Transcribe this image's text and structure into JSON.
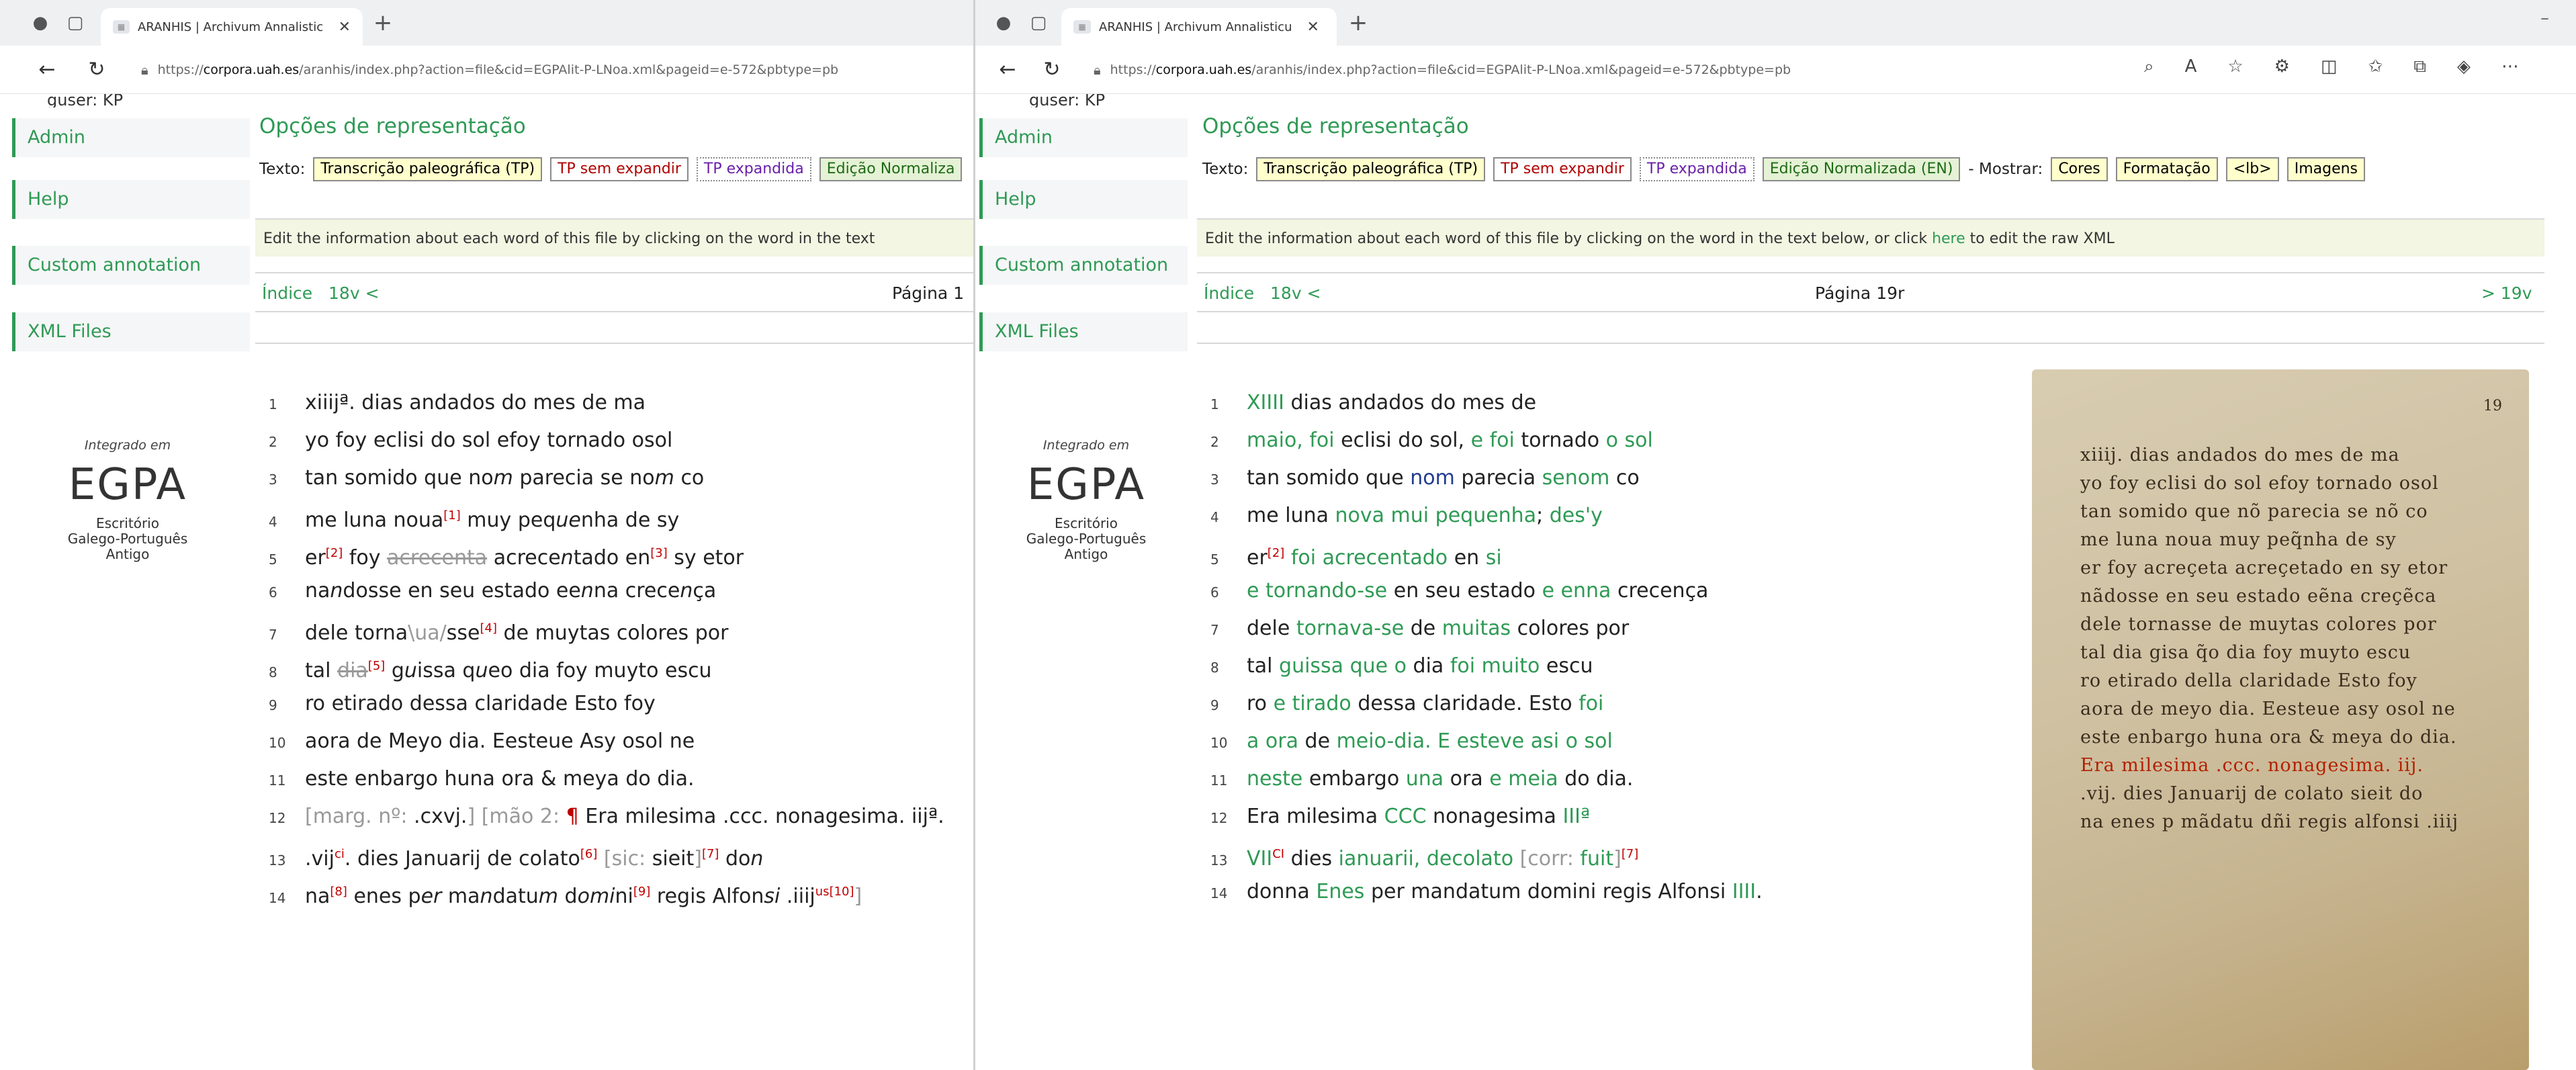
{
  "left": {
    "tab_title": "ARANHIS | Archivum Annalisticu",
    "url_host": "corpora.uah.es",
    "url_prefix": "https://",
    "url_path": "/aranhis/index.php?action=file&cid=EGPAlit-P-LNoa.xml&pageid=e-572&pbtype=pb",
    "sidebar_top": "guser: KP",
    "section_title": "Opções de representação",
    "texto_label": "Texto:",
    "options": [
      "Transcrição paleográfica (TP)",
      "TP sem expandir",
      "TP expandida",
      "Edição Normaliza"
    ],
    "info_text": "Edit the information about each word of this file by clicking on the word in the text",
    "index_link": "Índice",
    "prev_link": "18v <",
    "page_label": "Página 1",
    "lines": [
      {
        "n": "1",
        "parts": [
          {
            "t": "xiiijª. dias andados do mes de ma",
            "c": "tx"
          }
        ]
      },
      {
        "n": "2",
        "parts": [
          {
            "t": "yo foy eclisi do sol efoy tornado osol",
            "c": "tx"
          }
        ]
      },
      {
        "n": "3",
        "parts": [
          {
            "t": "tan somido que no",
            "c": "tx"
          },
          {
            "t": "m",
            "c": "tx it"
          },
          {
            "t": " parecia se no",
            "c": "tx"
          },
          {
            "t": "m",
            "c": "tx it"
          },
          {
            "t": " co",
            "c": "tx"
          }
        ]
      },
      {
        "n": "4",
        "parts": [
          {
            "t": "me luna noua",
            "c": "tx"
          },
          {
            "t": "[1]",
            "c": "sup"
          },
          {
            "t": " muy peq",
            "c": "tx"
          },
          {
            "t": "ue",
            "c": "tx it"
          },
          {
            "t": "nha de sy",
            "c": "tx"
          }
        ]
      },
      {
        "n": "5",
        "parts": [
          {
            "t": "er",
            "c": "tx"
          },
          {
            "t": "[2]",
            "c": "sup"
          },
          {
            "t": " foy ",
            "c": "tx"
          },
          {
            "t": "acrecenta",
            "c": "strike"
          },
          {
            "t": " acrece",
            "c": "tx"
          },
          {
            "t": "n",
            "c": "tx it"
          },
          {
            "t": "tado en",
            "c": "tx"
          },
          {
            "t": "[3]",
            "c": "sup"
          },
          {
            "t": " sy etor",
            "c": "tx"
          }
        ]
      },
      {
        "n": "6",
        "parts": [
          {
            "t": "na",
            "c": "tx"
          },
          {
            "t": "n",
            "c": "tx it"
          },
          {
            "t": "dosse en seu estado ee",
            "c": "tx"
          },
          {
            "t": "n",
            "c": "tx it"
          },
          {
            "t": "na crece",
            "c": "tx"
          },
          {
            "t": "n",
            "c": "tx it"
          },
          {
            "t": "ça",
            "c": "tx"
          }
        ]
      },
      {
        "n": "7",
        "parts": [
          {
            "t": "dele torna",
            "c": "tx"
          },
          {
            "t": "\\ua/",
            "c": "gray"
          },
          {
            "t": "sse",
            "c": "tx"
          },
          {
            "t": "[4]",
            "c": "sup"
          },
          {
            "t": " de muytas colores por",
            "c": "tx"
          }
        ]
      },
      {
        "n": "8",
        "parts": [
          {
            "t": "tal ",
            "c": "tx"
          },
          {
            "t": "dia",
            "c": "strike"
          },
          {
            "t": "[5]",
            "c": "sup"
          },
          {
            "t": " g",
            "c": "tx"
          },
          {
            "t": "u",
            "c": "tx it"
          },
          {
            "t": "issa q",
            "c": "tx"
          },
          {
            "t": "u",
            "c": "tx it"
          },
          {
            "t": "eo dia foy muyto escu",
            "c": "tx"
          }
        ]
      },
      {
        "n": "9",
        "parts": [
          {
            "t": "ro etirado dessa claridade Esto foy",
            "c": "tx"
          }
        ]
      },
      {
        "n": "10",
        "parts": [
          {
            "t": "aora de Meyo dia. Eesteue Asy osol ne",
            "c": "tx"
          }
        ]
      },
      {
        "n": "11",
        "parts": [
          {
            "t": "este enbargo huna ora & meya do dia.",
            "c": "tx"
          }
        ]
      },
      {
        "n": "12",
        "parts": [
          {
            "t": "[marg. nº: ",
            "c": "gray"
          },
          {
            "t": ".cxvj.",
            "c": "tx"
          },
          {
            "t": "] [mão 2: ",
            "c": "gray"
          },
          {
            "t": "¶",
            "c": "red"
          },
          {
            "t": " E",
            "c": "tx"
          },
          {
            "t": "ra milesima .ccc. nonagesima. iijª.",
            "c": "tx"
          }
        ]
      },
      {
        "n": "13",
        "parts": [
          {
            "t": ".vij",
            "c": "tx"
          },
          {
            "t": "ci",
            "c": "sup"
          },
          {
            "t": ". dies Januarij de colato",
            "c": "tx"
          },
          {
            "t": "[6]",
            "c": "sup"
          },
          {
            "t": " [sic: ",
            "c": "gray"
          },
          {
            "t": "sieit",
            "c": "tx"
          },
          {
            "t": "]",
            "c": "gray"
          },
          {
            "t": "[7]",
            "c": "sup"
          },
          {
            "t": " do",
            "c": "tx"
          },
          {
            "t": "n",
            "c": "tx it"
          }
        ]
      },
      {
        "n": "14",
        "parts": [
          {
            "t": "na",
            "c": "tx"
          },
          {
            "t": "[8]",
            "c": "sup"
          },
          {
            "t": " enes p",
            "c": "tx"
          },
          {
            "t": "er",
            "c": "tx it"
          },
          {
            "t": " ma",
            "c": "tx"
          },
          {
            "t": "n",
            "c": "tx it"
          },
          {
            "t": "datu",
            "c": "tx"
          },
          {
            "t": "m",
            "c": "tx it"
          },
          {
            "t": " d",
            "c": "tx"
          },
          {
            "t": "omi",
            "c": "tx it"
          },
          {
            "t": "ni",
            "c": "tx"
          },
          {
            "t": "[9]",
            "c": "sup"
          },
          {
            "t": " regis Alfon",
            "c": "tx"
          },
          {
            "t": "si",
            "c": "tx it"
          },
          {
            "t": " .iiij",
            "c": "tx"
          },
          {
            "t": "us",
            "c": "sup"
          },
          {
            "t": "[10]",
            "c": "sup"
          },
          {
            "t": "]",
            "c": "gray"
          }
        ]
      }
    ]
  },
  "right": {
    "tab_title": "ARANHIS | Archivum Annalisticu",
    "url_host": "corpora.uah.es",
    "url_prefix": "https://",
    "url_path": "/aranhis/index.php?action=file&cid=EGPAlit-P-LNoa.xml&pageid=e-572&pbtype=pb",
    "sidebar_top": "guser: KP",
    "section_title": "Opções de representação",
    "texto_label": "Texto:",
    "options": [
      "Transcrição paleográfica (TP)",
      "TP sem expandir",
      "TP expandida",
      "Edição Normalizada (EN)"
    ],
    "mostrar_label": "- Mostrar:",
    "show_options": [
      "Cores",
      "Formatação",
      "<lb>",
      "Imagens"
    ],
    "info_text": "Edit the information about each word of this file by clicking on the word in the text below, or click",
    "info_link": "here",
    "info_tail": "to edit the raw XML",
    "index_link": "Índice",
    "prev_link": "18v <",
    "page_label": "Página 19r",
    "next_link": "> 19v",
    "lines": [
      {
        "n": "1",
        "parts": [
          {
            "t": "XIIII",
            "c": "g"
          },
          {
            "t": " dias andados do mes de",
            "c": "tx"
          }
        ]
      },
      {
        "n": "2",
        "parts": [
          {
            "t": "maio, foi",
            "c": "g"
          },
          {
            "t": " eclisi do sol, ",
            "c": "tx"
          },
          {
            "t": "e foi",
            "c": "g"
          },
          {
            "t": " tornado ",
            "c": "tx"
          },
          {
            "t": "o sol",
            "c": "g"
          }
        ]
      },
      {
        "n": "3",
        "parts": [
          {
            "t": "tan somido que ",
            "c": "tx"
          },
          {
            "t": "nom",
            "c": "b"
          },
          {
            "t": " parecia ",
            "c": "tx"
          },
          {
            "t": "senom",
            "c": "g"
          },
          {
            "t": " co",
            "c": "tx"
          }
        ]
      },
      {
        "n": "4",
        "parts": [
          {
            "t": "me luna ",
            "c": "tx"
          },
          {
            "t": "nova mui pequenha",
            "c": "g"
          },
          {
            "t": "; ",
            "c": "tx"
          },
          {
            "t": "des'y",
            "c": "g"
          }
        ]
      },
      {
        "n": "5",
        "parts": [
          {
            "t": "er",
            "c": "tx"
          },
          {
            "t": "[2]",
            "c": "sup"
          },
          {
            "t": " ",
            "c": "tx"
          },
          {
            "t": "foi acrecentado",
            "c": "g"
          },
          {
            "t": " en ",
            "c": "tx"
          },
          {
            "t": "si",
            "c": "g"
          }
        ]
      },
      {
        "n": "6",
        "parts": [
          {
            "t": "e tornando-se",
            "c": "g"
          },
          {
            "t": " en seu estado ",
            "c": "tx"
          },
          {
            "t": "e enna",
            "c": "g"
          },
          {
            "t": " crecença",
            "c": "tx"
          }
        ]
      },
      {
        "n": "7",
        "parts": [
          {
            "t": "dele ",
            "c": "tx"
          },
          {
            "t": "tornava-se",
            "c": "g"
          },
          {
            "t": " de ",
            "c": "tx"
          },
          {
            "t": "muitas",
            "c": "g"
          },
          {
            "t": " colores por",
            "c": "tx"
          }
        ]
      },
      {
        "n": "8",
        "parts": [
          {
            "t": "tal ",
            "c": "tx"
          },
          {
            "t": "guissa que o",
            "c": "g"
          },
          {
            "t": " dia ",
            "c": "tx"
          },
          {
            "t": "foi muito",
            "c": "g"
          },
          {
            "t": " escu",
            "c": "tx"
          }
        ]
      },
      {
        "n": "9",
        "parts": [
          {
            "t": "ro ",
            "c": "tx"
          },
          {
            "t": "e tirado",
            "c": "g"
          },
          {
            "t": " dessa claridade. Esto ",
            "c": "tx"
          },
          {
            "t": "foi",
            "c": "g"
          }
        ]
      },
      {
        "n": "10",
        "parts": [
          {
            "t": "a ora",
            "c": "g"
          },
          {
            "t": " de ",
            "c": "tx"
          },
          {
            "t": "meio-dia. E esteve asi o sol",
            "c": "g"
          }
        ]
      },
      {
        "n": "11",
        "parts": [
          {
            "t": "neste",
            "c": "g"
          },
          {
            "t": " embargo ",
            "c": "tx"
          },
          {
            "t": "una",
            "c": "g"
          },
          {
            "t": " ora ",
            "c": "tx"
          },
          {
            "t": "e meia",
            "c": "g"
          },
          {
            "t": " do dia.",
            "c": "tx"
          }
        ]
      },
      {
        "n": "12",
        "parts": [
          {
            "t": "Era milesima ",
            "c": "tx"
          },
          {
            "t": "CCC",
            "c": "g"
          },
          {
            "t": " nonagesima ",
            "c": "tx"
          },
          {
            "t": "IIIª",
            "c": "g"
          }
        ]
      },
      {
        "n": "13",
        "parts": [
          {
            "t": "VII",
            "c": "g"
          },
          {
            "t": "CI",
            "c": "sup"
          },
          {
            "t": " dies ",
            "c": "tx"
          },
          {
            "t": "ianuarii, decolato",
            "c": "g"
          },
          {
            "t": " [corr: ",
            "c": "gray"
          },
          {
            "t": "fuit",
            "c": "g"
          },
          {
            "t": "]",
            "c": "gray"
          },
          {
            "t": "[7]",
            "c": "sup"
          }
        ]
      },
      {
        "n": "14",
        "parts": [
          {
            "t": "donna ",
            "c": "tx"
          },
          {
            "t": "Enes",
            "c": "g"
          },
          {
            "t": " per mandatum domini regis Alfonsi ",
            "c": "tx"
          },
          {
            "t": "IIII",
            "c": "g"
          },
          {
            "t": ".",
            "c": "tx"
          }
        ]
      }
    ],
    "manuscript": {
      "folio": "19",
      "lines": [
        "xiiij. dias andados do mes de ma",
        "yo foy eclisi do sol efoy tornado osol",
        "tan somido que nõ parecia se nõ co",
        "me luna noua muy peq̃nha de sy",
        "er foy acreçeta acreçetado en sy etor",
        "nãdosse en seu estado eẽna creçẽca",
        "dele tornasse de muytas colores por",
        "tal dia gisa q̃o dia foy muyto escu",
        "ro etirado della claridade Esto foy",
        "aora de meyo dia. Eesteue asy osol ne",
        "este enbargo huna ora & meya do dia.",
        "Era milesima .ccc. nonagesima. iij.",
        ".vij. dies Januarij de colato sieit do",
        "na enes p mãdatu dñi regis alfonsi .iiij"
      ]
    }
  }
}
